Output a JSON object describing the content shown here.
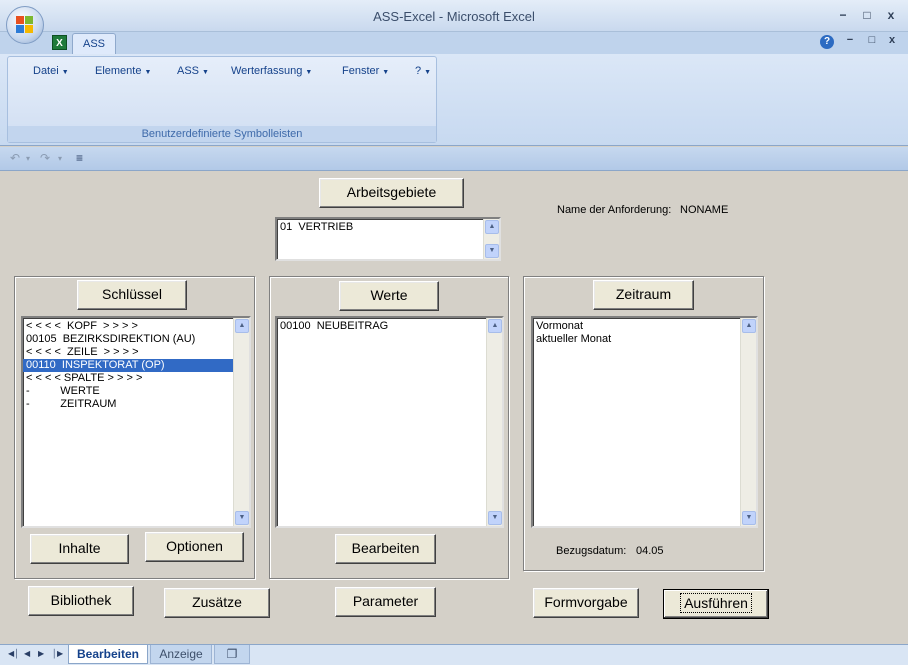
{
  "window": {
    "title": "ASS-Excel - Microsoft Excel",
    "minimize": "−",
    "maximize": "□",
    "close": "x"
  },
  "ribbon": {
    "tab_label": "ASS",
    "excel_icon_letter": "X",
    "help": "?",
    "menus": [
      {
        "label": "Datei"
      },
      {
        "label": "Elemente"
      },
      {
        "label": "ASS"
      },
      {
        "label": "Werterfassung"
      },
      {
        "label": "Fenster"
      },
      {
        "label": "?"
      }
    ],
    "menu_arrow": "▼",
    "group_label": "Benutzerdefinierte Symbolleisten"
  },
  "qat": {
    "undo": "↶",
    "redo": "↷",
    "dropdown": "▾",
    "customize": "≡"
  },
  "form": {
    "arbeitsgebiete_button": "Arbeitsgebiete",
    "arbeitsgebiete_list": [
      "01  VERTRIEB"
    ],
    "anforderung_label": "Name der Anforderung:",
    "anforderung_value": "NONAME",
    "schluessel": {
      "button": "Schlüssel",
      "items": [
        "< < < <  KOPF  > > > >",
        "00105  BEZIRKSDIREKTION (AU)",
        "< < < <  ZEILE  > > > >",
        "00110  INSPEKTORAT (OP)",
        "< < < < SPALTE > > > >",
        "-          WERTE",
        "-          ZEITRAUM"
      ],
      "selected_index": 3,
      "inhalte_button": "Inhalte",
      "optionen_button": "Optionen"
    },
    "werte": {
      "button": "Werte",
      "items": [
        "00100  NEUBEITRAG"
      ],
      "bearbeiten_button": "Bearbeiten"
    },
    "zeitraum": {
      "button": "Zeitraum",
      "items": [
        "Vormonat",
        "aktueller Monat"
      ],
      "bezugsdatum_label": "Bezugsdatum:",
      "bezugsdatum_value": "04.05"
    },
    "bibliothek_button": "Bibliothek",
    "zusaetze_button": "Zusätze",
    "parameter_button": "Parameter",
    "formvorgabe_button": "Formvorgabe",
    "ausfuehren_button": "Ausführen"
  },
  "sheets": {
    "nav": [
      "◀│",
      "◀",
      "▶",
      "│▶"
    ],
    "tabs": [
      {
        "label": "Bearbeiten",
        "active": true
      },
      {
        "label": "Anzeige",
        "active": false
      }
    ],
    "new_sheet_icon": "❐"
  },
  "colors": {
    "selection": "#316ac5",
    "form_bg": "#d4d0c8",
    "ribbon_text": "#15428b"
  }
}
